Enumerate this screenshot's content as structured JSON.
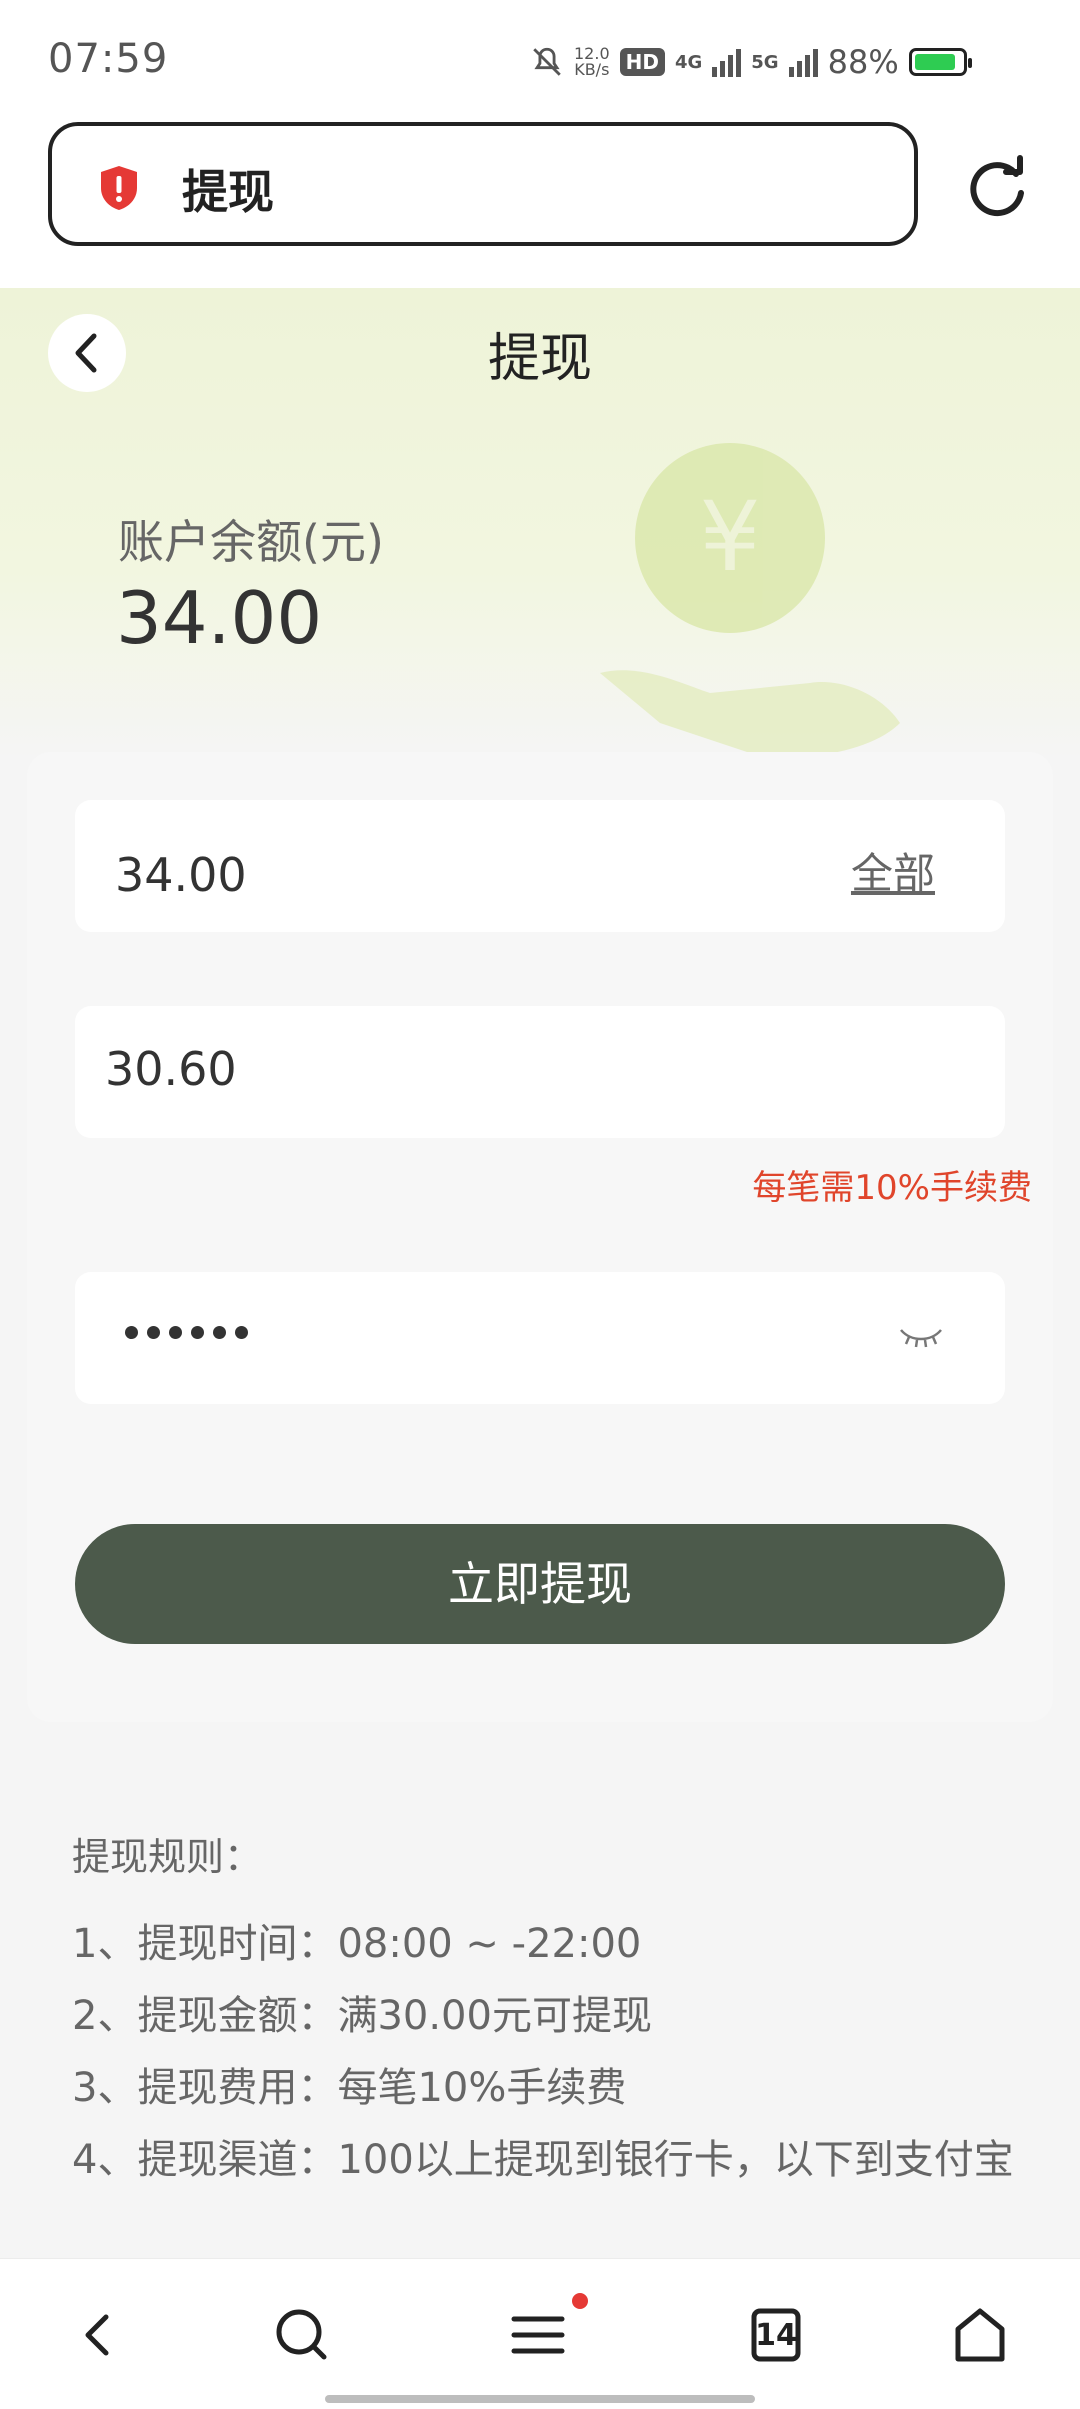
{
  "status_bar": {
    "time": "07:59",
    "net_speed_value": "12.0",
    "net_speed_unit": "KB/s",
    "hd_label": "HD",
    "sim1_label": "4G",
    "sim2_label": "5G",
    "battery_percent_text": "88%",
    "battery_level": 0.88
  },
  "browser": {
    "url_title": "提现",
    "security_icon": "shield-warning-icon",
    "refresh_icon": "refresh-icon"
  },
  "header": {
    "title": "提现",
    "back_icon": "chevron-left-icon"
  },
  "balance": {
    "label": "账户余额(元)",
    "value": "34.00"
  },
  "form": {
    "amount_value": "34.00",
    "all_label": "全部",
    "received_value": "30.60",
    "fee_hint": "每笔需10%手续费",
    "password_mask_count": 6,
    "eye_icon": "eye-closed-icon",
    "submit_label": "立即提现"
  },
  "rules": {
    "title": "提现规则：",
    "items": [
      "1、提现时间：08:00 ~ -22:00",
      "2、提现金额：满30.00元可提现",
      "3、提现费用：每笔10%手续费",
      "4、提现渠道：100以上提现到银行卡，以下到支付宝"
    ]
  },
  "bottom_nav": {
    "tabs_count": "14",
    "icons": [
      "back-icon",
      "search-icon",
      "menu-icon",
      "tabs-icon",
      "home-icon"
    ]
  },
  "colors": {
    "accent_button": "#4c5a4b",
    "hint_red": "#e0452b",
    "hero_tint": "#eef3d8"
  }
}
